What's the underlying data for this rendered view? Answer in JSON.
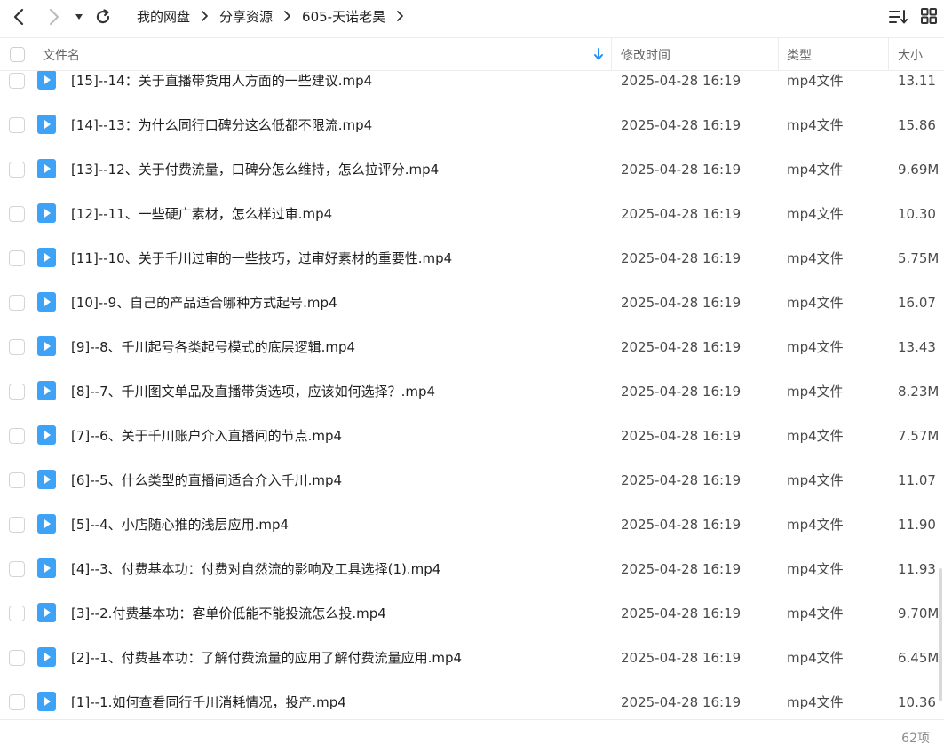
{
  "breadcrumb": [
    "我的网盘",
    "分享资源",
    "605-天诺老昊"
  ],
  "columns": {
    "name": "文件名",
    "modified": "修改时间",
    "type": "类型",
    "size": "大小"
  },
  "files": [
    {
      "name": "[15]--14：关于直播带货用人方面的一些建议.mp4",
      "modified": "2025-04-28 16:19",
      "type": "mp4文件",
      "size": "13.11"
    },
    {
      "name": "[14]--13：为什么同行口碑分这么低都不限流.mp4",
      "modified": "2025-04-28 16:19",
      "type": "mp4文件",
      "size": "15.86"
    },
    {
      "name": "[13]--12、关于付费流量，口碑分怎么维持，怎么拉评分.mp4",
      "modified": "2025-04-28 16:19",
      "type": "mp4文件",
      "size": "9.69M"
    },
    {
      "name": "[12]--11、一些硬广素材，怎么样过审.mp4",
      "modified": "2025-04-28 16:19",
      "type": "mp4文件",
      "size": "10.30"
    },
    {
      "name": "[11]--10、关于千川过审的一些技巧，过审好素材的重要性.mp4",
      "modified": "2025-04-28 16:19",
      "type": "mp4文件",
      "size": "5.75M"
    },
    {
      "name": "[10]--9、自己的产品适合哪种方式起号.mp4",
      "modified": "2025-04-28 16:19",
      "type": "mp4文件",
      "size": "16.07"
    },
    {
      "name": "[9]--8、千川起号各类起号模式的底层逻辑.mp4",
      "modified": "2025-04-28 16:19",
      "type": "mp4文件",
      "size": "13.43"
    },
    {
      "name": "[8]--7、千川图文单品及直播带货选项，应该如何选择？.mp4",
      "modified": "2025-04-28 16:19",
      "type": "mp4文件",
      "size": "8.23M"
    },
    {
      "name": "[7]--6、关于千川账户介入直播间的节点.mp4",
      "modified": "2025-04-28 16:19",
      "type": "mp4文件",
      "size": "7.57M"
    },
    {
      "name": "[6]--5、什么类型的直播间适合介入千川.mp4",
      "modified": "2025-04-28 16:19",
      "type": "mp4文件",
      "size": "11.07"
    },
    {
      "name": "[5]--4、小店随心推的浅层应用.mp4",
      "modified": "2025-04-28 16:19",
      "type": "mp4文件",
      "size": "11.90"
    },
    {
      "name": "[4]--3、付费基本功：付费对自然流的影响及工具选择(1).mp4",
      "modified": "2025-04-28 16:19",
      "type": "mp4文件",
      "size": "11.93"
    },
    {
      "name": "[3]--2.付费基本功：客单价低能不能投流怎么投.mp4",
      "modified": "2025-04-28 16:19",
      "type": "mp4文件",
      "size": "9.70M"
    },
    {
      "name": "[2]--1、付费基本功：了解付费流量的应用了解付费流量应用.mp4",
      "modified": "2025-04-28 16:19",
      "type": "mp4文件",
      "size": "6.45M"
    },
    {
      "name": "[1]--1.如何查看同行千川消耗情况，投产.mp4",
      "modified": "2025-04-28 16:19",
      "type": "mp4文件",
      "size": "10.36"
    }
  ],
  "footer": {
    "count": "62项"
  },
  "colors": {
    "accent": "#1e90ff",
    "video_icon": "#3ea3f6"
  },
  "icons": {
    "back": "chevron-left-icon",
    "forward": "chevron-right-icon",
    "history": "caret-down-icon",
    "refresh": "refresh-icon",
    "sort": "sort-list-icon",
    "view": "grid-view-icon",
    "file": "video-file-icon"
  }
}
